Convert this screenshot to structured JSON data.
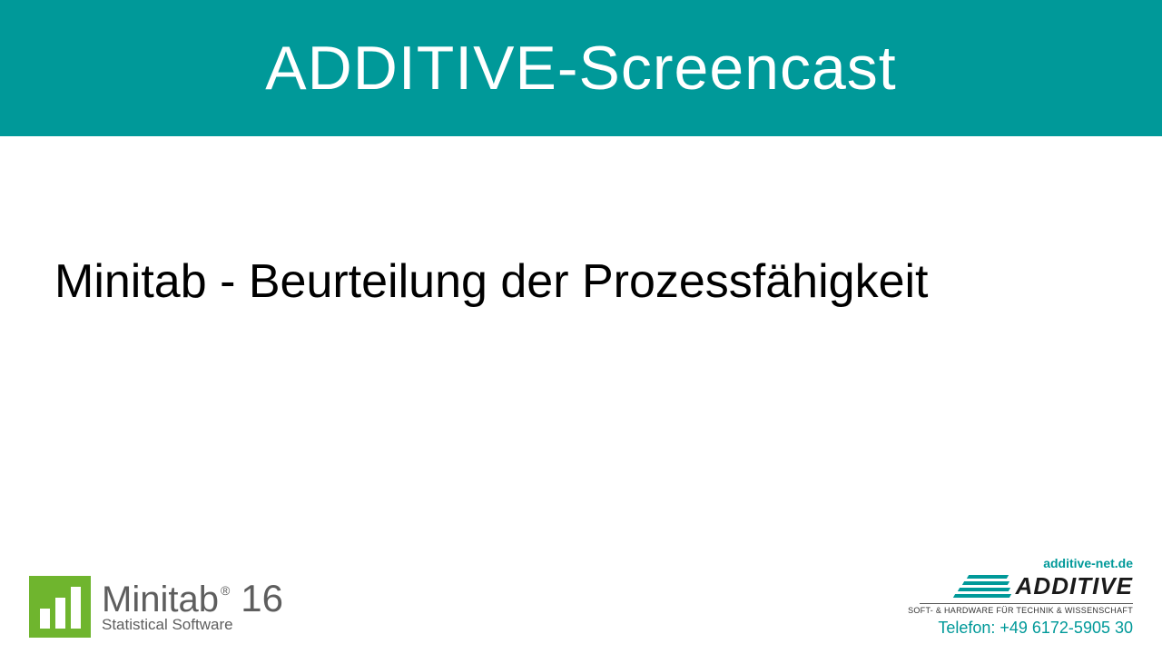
{
  "header": {
    "title": "ADDITIVE-Screencast"
  },
  "main": {
    "subtitle": "Minitab - Beurteilung der Prozessfähigkeit"
  },
  "minitab": {
    "name": "Minitab",
    "registered": "®",
    "version": "16",
    "tagline": "Statistical Software"
  },
  "additive": {
    "url": "additive-net.de",
    "name": "ADDITIVE",
    "tagline": "SOFT- & HARDWARE FÜR TECHNIK & WISSENSCHAFT",
    "phone": "Telefon: +49 6172-5905 30"
  }
}
